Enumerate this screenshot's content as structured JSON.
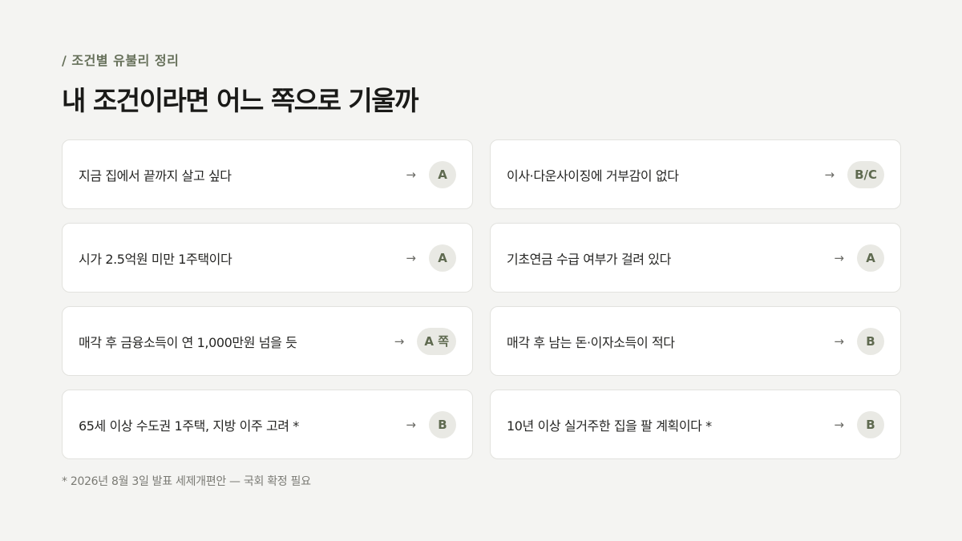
{
  "header": {
    "eyebrow": "/ 조건별 유불리 정리",
    "title": "내 조건이라면 어느 쪽으로 기울까"
  },
  "rows": [
    {
      "text": "지금 집에서 끝까지 살고 싶다",
      "badge": "A"
    },
    {
      "text": "이사·다운사이징에 거부감이 없다",
      "badge": "B/C"
    },
    {
      "text": "시가 2.5억원 미만 1주택이다",
      "badge": "A"
    },
    {
      "text": "기초연금 수급 여부가 걸려 있다",
      "badge": "A"
    },
    {
      "text": "매각 후 금융소득이 연 1,000만원 넘을 듯",
      "badge": "A 쪽"
    },
    {
      "text": "매각 후 남는 돈·이자소득이 적다",
      "badge": "B"
    },
    {
      "text": "65세 이상 수도권 1주택, 지방 이주 고려 *",
      "badge": "B"
    },
    {
      "text": "10년 이상 실거주한 집을 팔 계획이다 *",
      "badge": "B"
    }
  ],
  "arrow_glyph": "→",
  "footnote": "* 2026년 8월 3일 발표 세제개편안 — 국회 확정 필요",
  "colors": {
    "background": "#f4f4f2",
    "accent": "#66705a",
    "badge_bg": "#e9e9e4"
  }
}
